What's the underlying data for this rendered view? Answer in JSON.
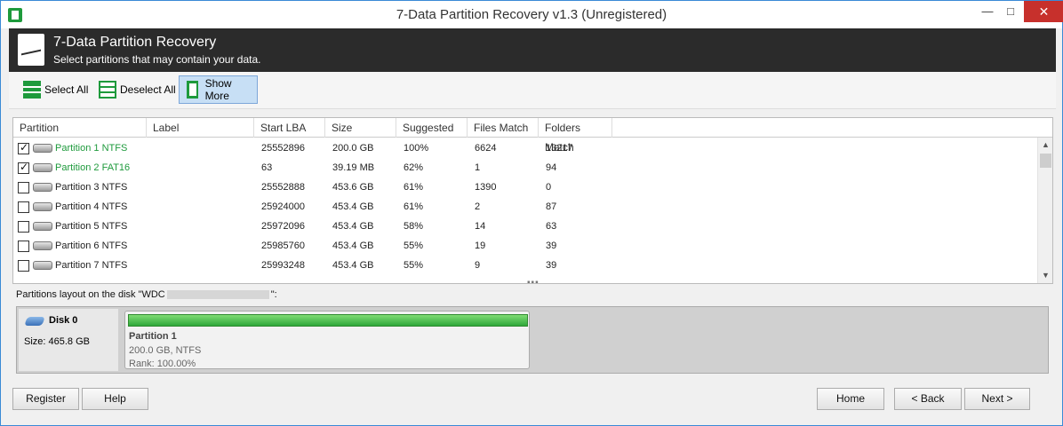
{
  "window": {
    "title": "7-Data Partition Recovery v1.3 (Unregistered)",
    "min_glyph": "—",
    "max_glyph": "□",
    "close_glyph": "✕"
  },
  "header": {
    "title": "7-Data Partition Recovery",
    "subtitle": "Select partitions that may contain your data."
  },
  "toolbar": {
    "select_all": "Select All",
    "deselect_all": "Deselect All",
    "show_more": "Show More"
  },
  "table": {
    "columns": [
      "Partition",
      "Label",
      "Start LBA",
      "Size",
      "Suggested",
      "Files Match",
      "Folders Match"
    ],
    "rows": [
      {
        "checked": true,
        "name": "Partition 1 NTFS",
        "label": "",
        "start_lba": "25552896",
        "size": "200.0 GB",
        "suggested": "100%",
        "files": "6624",
        "folders": "13217"
      },
      {
        "checked": true,
        "name": "Partition 2 FAT16",
        "label": "",
        "start_lba": "63",
        "size": "39.19 MB",
        "suggested": "62%",
        "files": "1",
        "folders": "94"
      },
      {
        "checked": false,
        "name": "Partition 3 NTFS",
        "label": "",
        "start_lba": "25552888",
        "size": "453.6 GB",
        "suggested": "61%",
        "files": "1390",
        "folders": "0"
      },
      {
        "checked": false,
        "name": "Partition 4 NTFS",
        "label": "",
        "start_lba": "25924000",
        "size": "453.4 GB",
        "suggested": "61%",
        "files": "2",
        "folders": "87"
      },
      {
        "checked": false,
        "name": "Partition 5 NTFS",
        "label": "",
        "start_lba": "25972096",
        "size": "453.4 GB",
        "suggested": "58%",
        "files": "14",
        "folders": "63"
      },
      {
        "checked": false,
        "name": "Partition 6 NTFS",
        "label": "",
        "start_lba": "25985760",
        "size": "453.4 GB",
        "suggested": "55%",
        "files": "19",
        "folders": "39"
      },
      {
        "checked": false,
        "name": "Partition 7 NTFS",
        "label": "",
        "start_lba": "25993248",
        "size": "453.4 GB",
        "suggested": "55%",
        "files": "9",
        "folders": "39"
      }
    ]
  },
  "layout": {
    "label_prefix": "Partitions layout on the disk \"WDC",
    "label_suffix": "\":",
    "disk_name": "Disk 0",
    "disk_size": "Size: 465.8 GB",
    "partition_title": "Partition 1",
    "partition_detail": "200.0 GB, NTFS",
    "partition_rank": "Rank: 100.00%"
  },
  "buttons": {
    "register": "Register",
    "help": "Help",
    "home": "Home",
    "back": "< Back",
    "next": "Next >"
  }
}
